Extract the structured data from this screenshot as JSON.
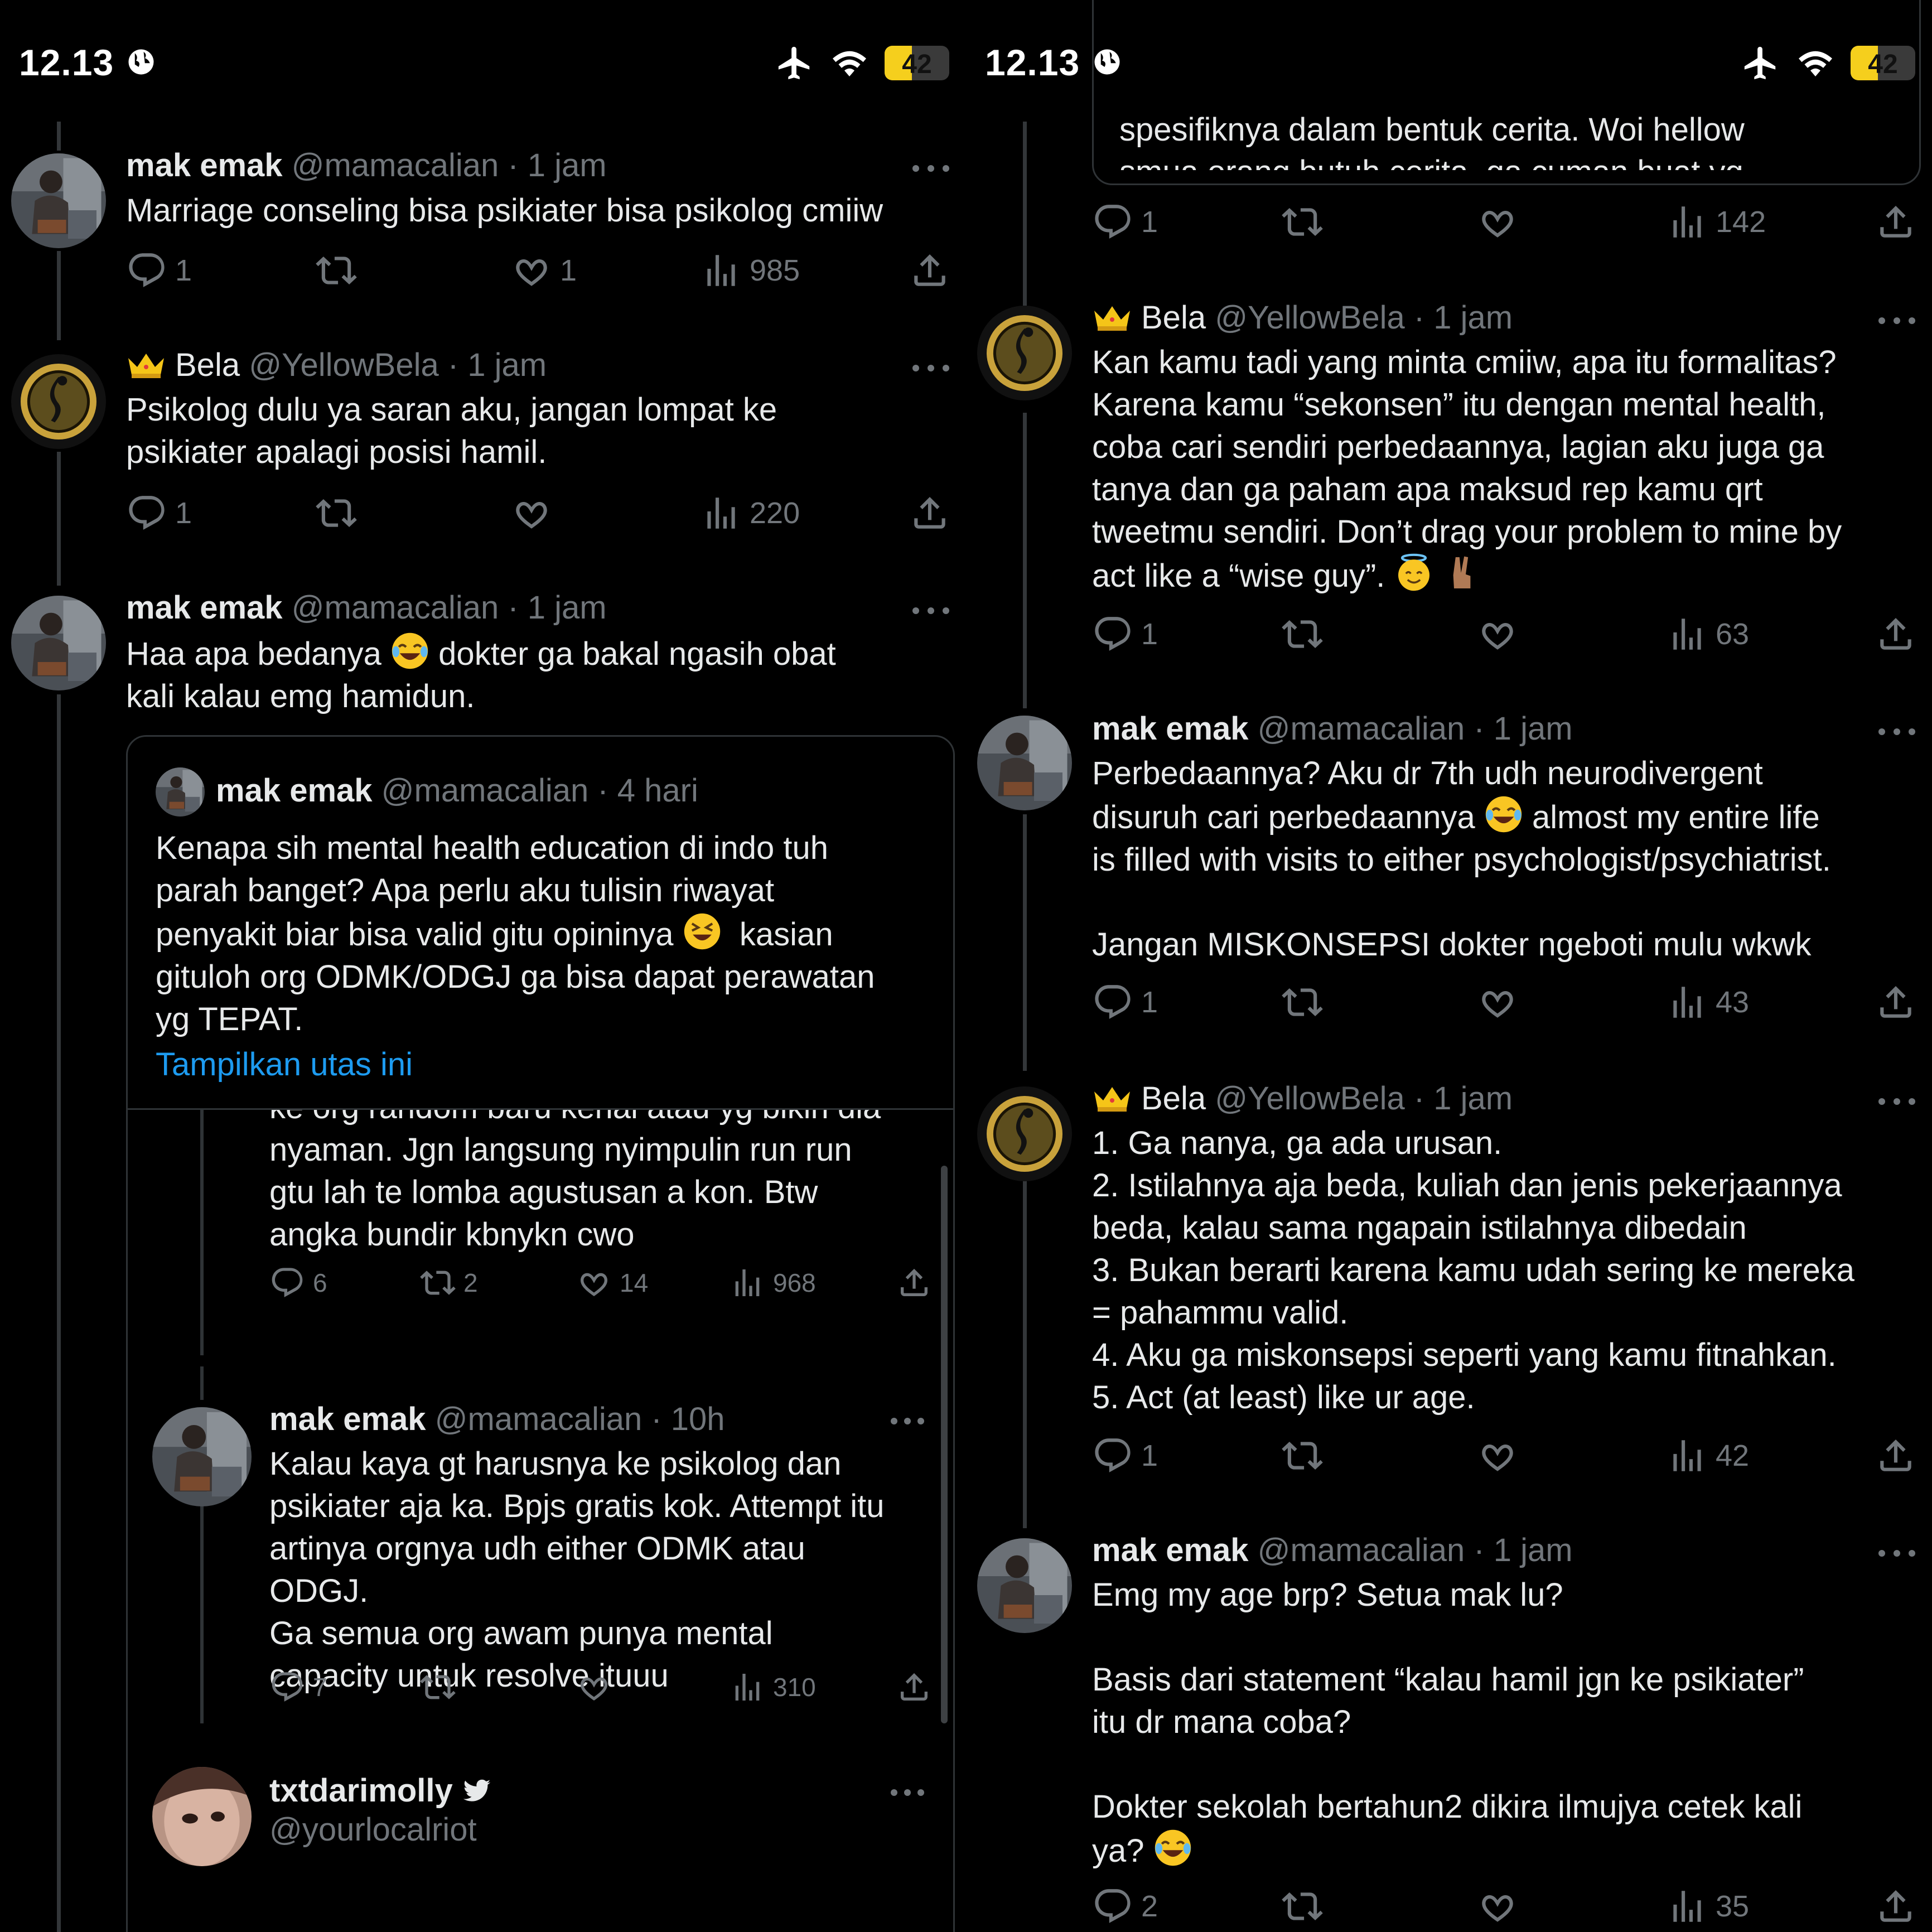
{
  "status": {
    "time": "12.13",
    "battery": "42",
    "battery_level": 0.42
  },
  "left": {
    "tweets": [
      {
        "name": "mak emak",
        "handle": "@mamacalian",
        "time": "· 1 jam",
        "text": "Marriage conseling bisa psikiater bisa psikolog cmiiw",
        "reply": "1",
        "retweet": "",
        "like": "1",
        "views": "985"
      },
      {
        "name": "Bela",
        "handle": "@YellowBela",
        "time": "· 1 jam",
        "text": "Psikolog dulu ya saran aku, jangan lompat ke\npsikiater apalagi posisi hamil.",
        "reply": "1",
        "retweet": "",
        "like": "",
        "views": "220"
      },
      {
        "name": "mak emak",
        "handle": "@mamacalian",
        "time": "· 1 jam",
        "text_a": "Haa apa bedanya ",
        "text_b": " dokter ga bakal ngasih obat\nkali kalau emg hamidun."
      }
    ],
    "quote": {
      "name": "mak emak",
      "handle": "@mamacalian",
      "time": "· 4 hari",
      "text_a": "Kenapa sih mental health education di indo tuh\nparah banget? Apa perlu aku tulisin riwayat\npenyakit biar bisa valid gitu opininya ",
      "text_b": "  kasian\ngituloh org ODMK/ODGJ ga bisa dapat perawatan\nyg TEPAT.",
      "show_thread": "Tampilkan utas ini"
    },
    "embedded": {
      "partial_text": "ke org random baru kenal atau yg bikin dia\nnyaman. Jgn langsung nyimpulin run run\ngtu lah te lomba agustusan a kon. Btw\nangka bundir kbnykn cwo",
      "partial_stats": {
        "reply": "6",
        "retweet": "2",
        "like": "14",
        "views": "968"
      },
      "reply_tweet": {
        "name": "mak emak",
        "handle": "@mamacalian",
        "time": "· 10h",
        "text": "Kalau kaya gt harusnya ke psikolog dan\npsikiater aja ka. Bpjs gratis kok. Attempt itu\nartinya orgnya udh either ODMK atau\nODGJ.\nGa semua org awam punya mental\ncapacity untuk resolve ituuu",
        "reply": "7",
        "retweet": "",
        "like": "",
        "views": "310"
      },
      "molly": {
        "name": "txtdarimolly",
        "handle": "@yourlocalriot"
      }
    }
  },
  "right": {
    "top_partial_text": "spesifiknya dalam bentuk cerita. Woi hellow\nsmua orang butuh cerita, ga cuman buat yg",
    "top_stats": {
      "reply": "1",
      "retweet": "",
      "like": "",
      "views": "142"
    },
    "tweets": [
      {
        "name": "Bela",
        "handle": "@YellowBela",
        "time": "· 1 jam",
        "text": "Kan kamu tadi yang minta cmiiw, apa itu formalitas?\nKarena kamu “sekonsen” itu dengan mental health,\ncoba cari sendiri perbedaannya, lagian aku juga ga\ntanya dan ga paham apa maksud rep kamu qrt\ntweetmu sendiri. Don’t drag your problem to mine by\nact like a “wise guy”. ",
        "reply": "1",
        "retweet": "",
        "like": "",
        "views": "63"
      },
      {
        "name": "mak emak",
        "handle": "@mamacalian",
        "time": "· 1 jam",
        "text_a": "Perbedaannya? Aku dr 7th udh neurodivergent\ndisuruh cari perbedaannya ",
        "text_b": " almost my entire life\nis filled with visits to either psychologist/psychiatrist.\n\nJangan MISKONSEPSI dokter ngeboti mulu wkwk",
        "reply": "1",
        "retweet": "",
        "like": "",
        "views": "43"
      },
      {
        "name": "Bela",
        "handle": "@YellowBela",
        "time": "· 1 jam",
        "text": "1. Ga nanya, ga ada urusan.\n2. Istilahnya aja beda, kuliah dan jenis pekerjaannya\nbeda, kalau sama ngapain istilahnya dibedain\n3. Bukan berarti karena kamu udah sering ke mereka\n= pahammu valid.\n4. Aku ga miskonsepsi seperti yang kamu fitnahkan.\n5. Act (at least) like ur age.",
        "reply": "1",
        "retweet": "",
        "like": "",
        "views": "42"
      },
      {
        "name": "mak emak",
        "handle": "@mamacalian",
        "time": "· 1 jam",
        "text_a": "Emg my age brp? Setua mak lu?\n\nBasis dari statement “kalau hamil jgn ke psikiater”\nitu dr mana coba?\n\nDokter sekolah bertahun2 dikira ilmujya cetek kali\nya? ",
        "reply": "2",
        "retweet": "",
        "like": "",
        "views": "35"
      }
    ]
  },
  "icons": [
    "globe-icon",
    "airplane-icon",
    "wifi-icon",
    "battery-icon",
    "reply-icon",
    "retweet-icon",
    "like-icon",
    "views-icon",
    "share-icon",
    "more-icon",
    "crown-icon",
    "verified-bird-icon"
  ]
}
